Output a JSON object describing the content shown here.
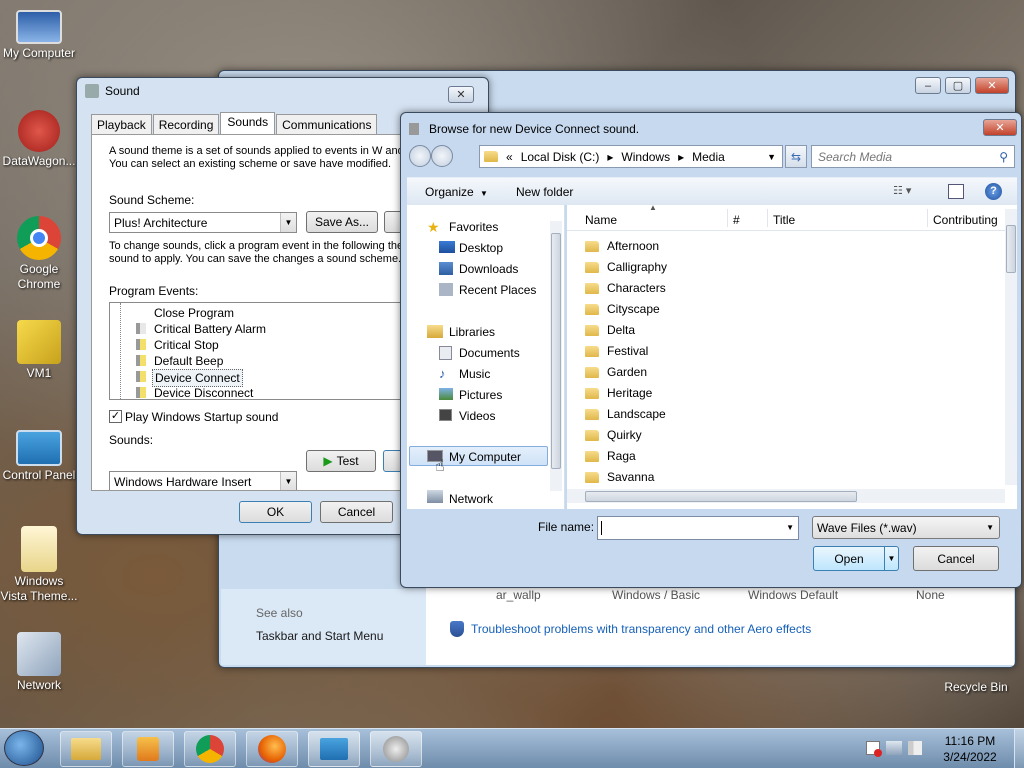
{
  "desktop": {
    "icons": [
      {
        "label": "My Computer"
      },
      {
        "label": "DataWagon..."
      },
      {
        "label": "Google Chrome"
      },
      {
        "label": "VM1"
      },
      {
        "label": "Control Panel"
      },
      {
        "label": "Windows Vista Theme..."
      },
      {
        "label": "Network"
      },
      {
        "label": "Recycle Bin"
      }
    ]
  },
  "personalize_bg": {
    "table_row": [
      "ar_wallp",
      "Windows / Basic",
      "Windows Default",
      "None"
    ],
    "see_also": "See also",
    "taskbar_link": "Taskbar and Start Menu",
    "troubleshoot": "Troubleshoot problems with transparency and other Aero effects"
  },
  "sound": {
    "title": "Sound",
    "tabs": [
      "Playback",
      "Recording",
      "Sounds",
      "Communications"
    ],
    "description": "A sound theme is a set of sounds applied to events in W and programs.  You can select an existing scheme or save have modified.",
    "scheme_label": "Sound Scheme:",
    "scheme_value": "Plus! Architecture",
    "save_as": "Save As...",
    "change_text": "To change sounds, click a program event in the following then select a sound to apply.  You can save the changes a sound scheme.",
    "events_label": "Program Events:",
    "events": [
      "Close Program",
      "Critical Battery Alarm",
      "Critical Stop",
      "Default Beep",
      "Device Connect",
      "Device Disconnect"
    ],
    "startup_label": "Play Windows Startup sound",
    "sounds_label": "Sounds:",
    "sounds_value": "Windows Hardware Insert",
    "test": "Test",
    "ok": "OK",
    "cancel": "Cancel"
  },
  "browse": {
    "title": "Browse for new Device Connect sound.",
    "path": [
      "Local Disk (C:)",
      "Windows",
      "Media"
    ],
    "search_placeholder": "Search Media",
    "organize": "Organize",
    "new_folder": "New folder",
    "nav": {
      "favorites": "Favorites",
      "fav_items": [
        "Desktop",
        "Downloads",
        "Recent Places"
      ],
      "libraries": "Libraries",
      "lib_items": [
        "Documents",
        "Music",
        "Pictures",
        "Videos"
      ],
      "computer": "My Computer",
      "network": "Network"
    },
    "columns": [
      "Name",
      "#",
      "Title",
      "Contributing"
    ],
    "folders": [
      "Afternoon",
      "Calligraphy",
      "Characters",
      "Cityscape",
      "Delta",
      "Festival",
      "Garden",
      "Heritage",
      "Landscape",
      "Quirky",
      "Raga",
      "Savanna"
    ],
    "file_name_label": "File name:",
    "file_name_value": "",
    "file_type": "Wave Files (*.wav)",
    "open": "Open",
    "cancel": "Cancel"
  },
  "taskbar": {
    "time": "11:16 PM",
    "date": "3/24/2022"
  }
}
